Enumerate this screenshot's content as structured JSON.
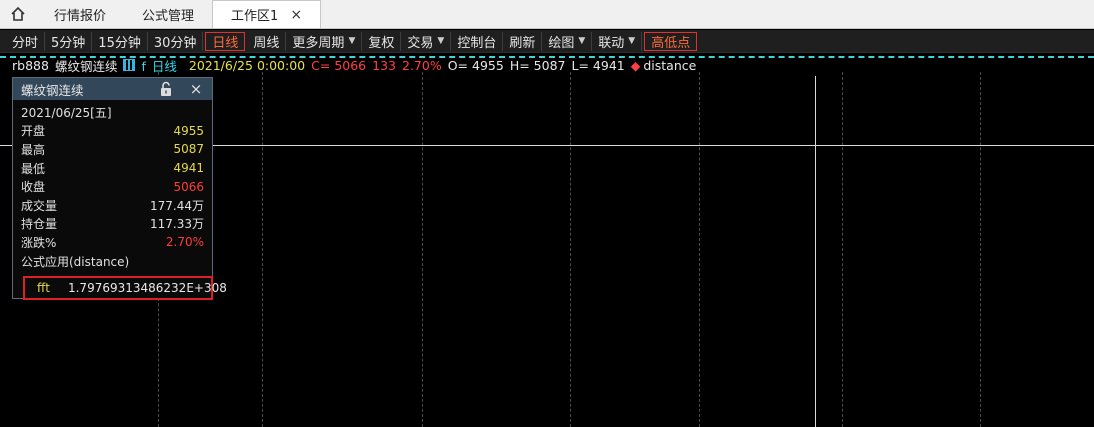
{
  "tabs": [
    {
      "label": "行情报价"
    },
    {
      "label": "公式管理"
    },
    {
      "label": "工作区1",
      "close": "×"
    }
  ],
  "toolbar": [
    {
      "label": "分时"
    },
    {
      "label": "5分钟"
    },
    {
      "label": "15分钟"
    },
    {
      "label": "30分钟"
    },
    {
      "label": "日线",
      "selected": true
    },
    {
      "label": "周线"
    },
    {
      "label": "更多周期",
      "dropdown": "▼"
    },
    {
      "label": "复权"
    },
    {
      "label": "交易",
      "dropdown": "▼"
    },
    {
      "label": "控制台"
    },
    {
      "label": "刷新"
    },
    {
      "label": "绘图",
      "dropdown": "▼"
    },
    {
      "label": "联动",
      "dropdown": "▼"
    },
    {
      "label": "高低点",
      "selected": true
    }
  ],
  "info": {
    "symbol": "rb888",
    "name": "螺纹钢连续",
    "period": "日线",
    "period_prefix": "f",
    "datetime": "2021/6/25 0:00:00",
    "close": "C= 5066",
    "change": "133",
    "pct": "2.70%",
    "open": "O= 4955",
    "high": "H= 5087",
    "low": "L= 4941",
    "indicator_marker": "◆",
    "indicator": "distance"
  },
  "panel": {
    "title": "螺纹钢连续",
    "close": "×",
    "date": "2021/06/25[五]",
    "rows": [
      {
        "k": "开盘",
        "v": "4955"
      },
      {
        "k": "最高",
        "v": "5087"
      },
      {
        "k": "最低",
        "v": "4941"
      },
      {
        "k": "收盘",
        "v": "5066"
      },
      {
        "k": "成交量",
        "v": "177.44万"
      },
      {
        "k": "持仓量",
        "v": "117.33万"
      },
      {
        "k": "涨跌%",
        "v": "2.70%"
      }
    ],
    "formula_label": "公式应用(distance)",
    "fft_label": "fft",
    "fft_value": "1.79769313486232E+308"
  },
  "colors": {
    "accent_red": "#e02020",
    "price_yellow": "#e6d84a",
    "up_red": "#ff3b3b",
    "cyan": "#30d8e8"
  }
}
